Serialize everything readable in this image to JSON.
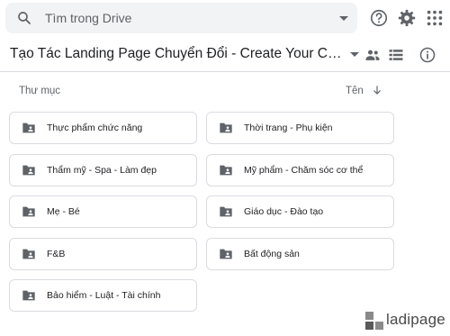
{
  "search": {
    "placeholder": "Tìm trong Drive"
  },
  "header": {
    "icons": [
      "help-icon",
      "settings-icon",
      "apps-grid-icon"
    ]
  },
  "folder_path": {
    "title": "Tạo Tác Landing Page Chuyển Đổi - Create Your Conversion M...",
    "icons": [
      "shared-people-icon",
      "list-view-icon",
      "info-icon"
    ]
  },
  "section": {
    "label": "Thư mục",
    "sort_label": "Tên"
  },
  "folders": [
    {
      "label": "Thực phẩm chức năng"
    },
    {
      "label": "Thời trang - Phụ kiện"
    },
    {
      "label": "Thẩm mỹ - Spa - Làm đẹp"
    },
    {
      "label": "Mỹ phẩm - Chăm sóc cơ thể"
    },
    {
      "label": "Mẹ - Bé"
    },
    {
      "label": "Giáo dục - Đào tạo"
    },
    {
      "label": "F&B"
    },
    {
      "label": "Bất động sản"
    },
    {
      "label": "Bảo hiểm - Luật - Tài chính"
    }
  ],
  "brand": {
    "name": "ladipage"
  },
  "colors": {
    "icon": "#5f6368",
    "text": "#202124",
    "border": "#dadce0",
    "search_bg": "#f1f3f4"
  }
}
